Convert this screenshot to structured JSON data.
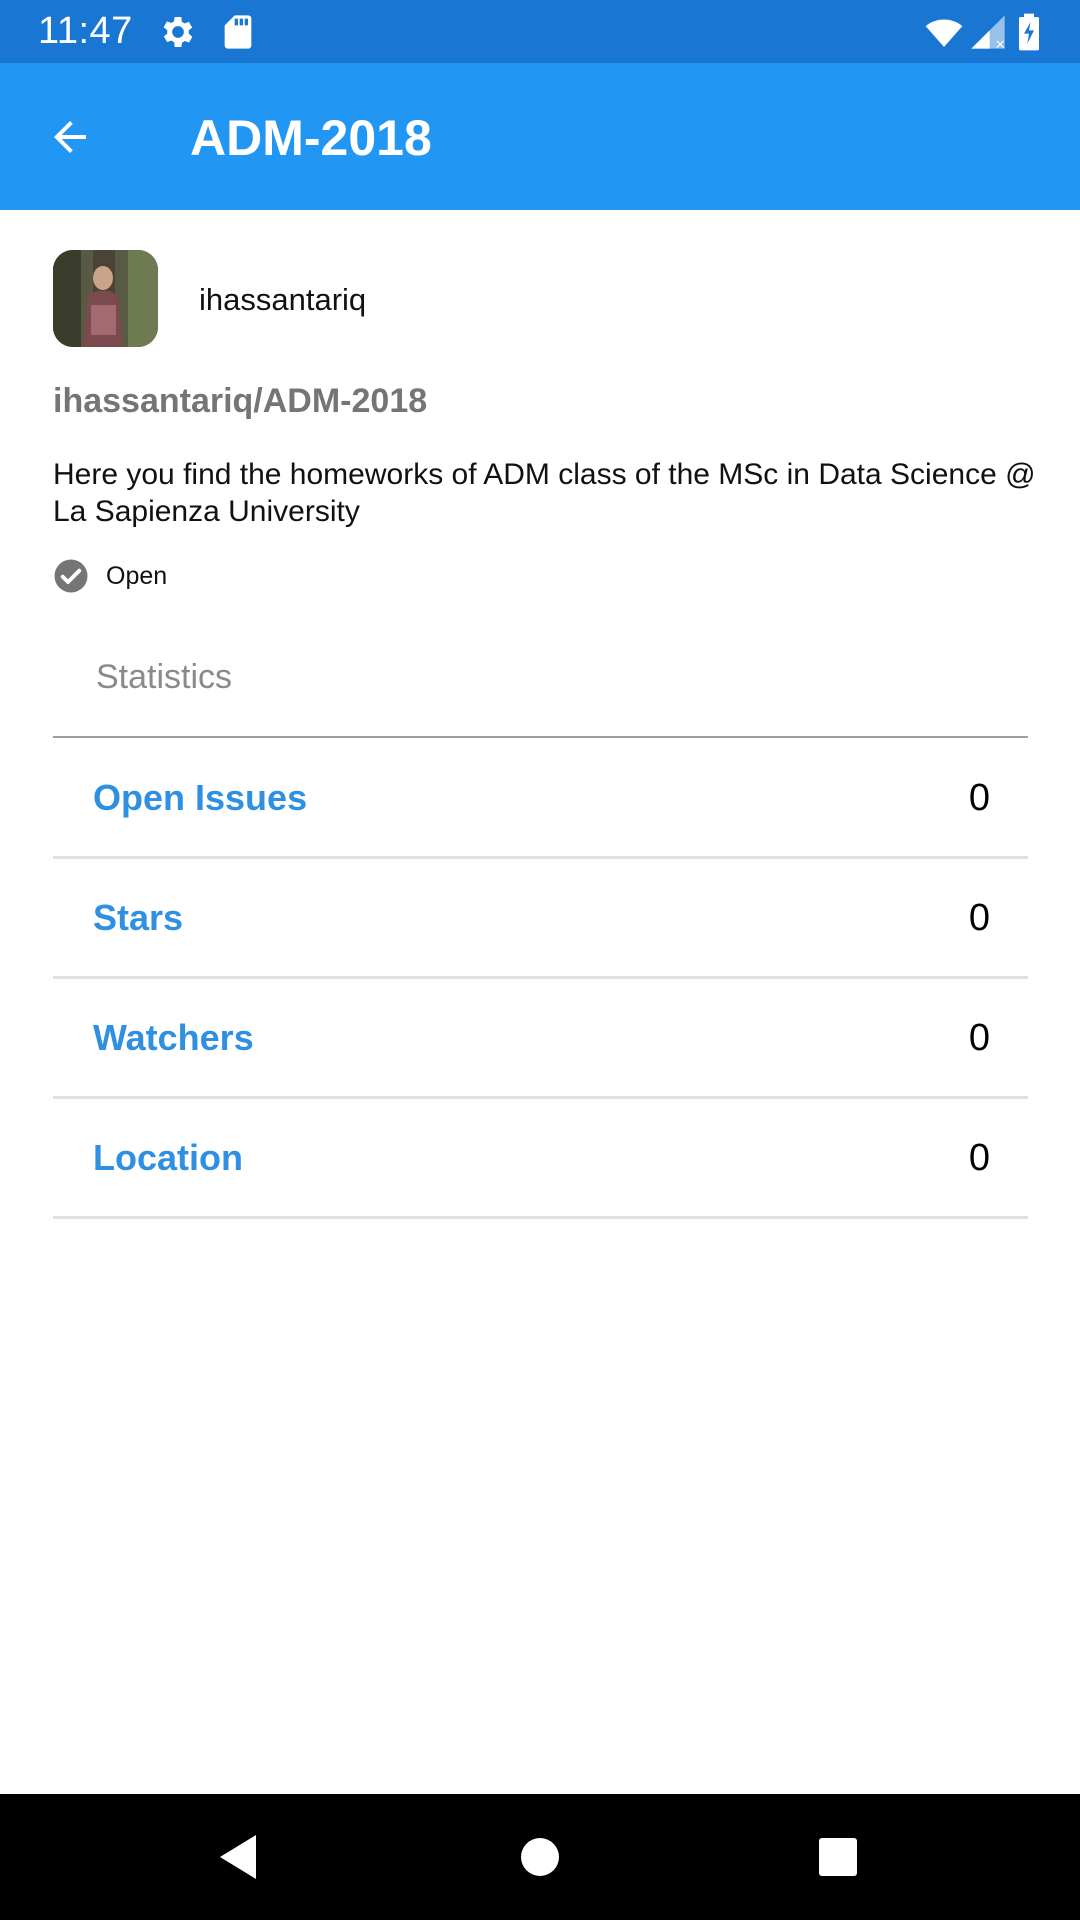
{
  "status_bar": {
    "time": "11:47",
    "icons": [
      "gear-icon",
      "sd-card-icon",
      "wifi-icon",
      "signal-icon",
      "battery-charging-icon"
    ]
  },
  "app_bar": {
    "title": "ADM-2018",
    "back_icon": "arrow-back-icon",
    "color": "#2196f3"
  },
  "repo": {
    "owner": "ihassantariq",
    "full_name": "ihassantariq/ADM-2018",
    "description": "Here you find the homeworks of ADM class of the MSc in Data Science @ La Sapienza University",
    "state": "Open"
  },
  "statistics": {
    "header": "Statistics",
    "rows": [
      {
        "label": "Open Issues",
        "value": "0"
      },
      {
        "label": "Stars",
        "value": "0"
      },
      {
        "label": "Watchers",
        "value": "0"
      },
      {
        "label": "Location",
        "value": "0"
      }
    ]
  },
  "nav_bar": {
    "buttons": [
      "back-triangle-icon",
      "home-circle-icon",
      "recents-square-icon"
    ]
  }
}
